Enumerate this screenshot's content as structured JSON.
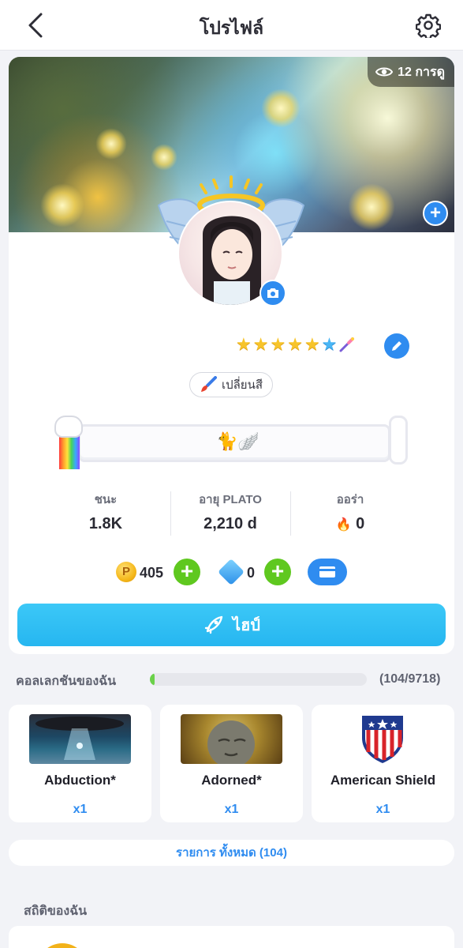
{
  "header": {
    "title": "โปรไฟล์"
  },
  "banner": {
    "views_label": "12 การดู"
  },
  "profile": {
    "change_color_label": "เปลี่ยนสี"
  },
  "stats": [
    {
      "label": "ชนะ",
      "value": "1.8K"
    },
    {
      "label": "อายุ PLATO",
      "value": "2,210 d"
    },
    {
      "label": "ออร่า",
      "value": "0"
    }
  ],
  "currency": {
    "coins": "405",
    "coin_symbol": "P",
    "gems": "0"
  },
  "hype_button_label": "ไฮป์",
  "collection": {
    "title": "คอลเลกชันของฉัน",
    "count_label": "(104/9718)",
    "progress": 0.0107,
    "items": [
      {
        "name": "Abduction*",
        "qty": "x1"
      },
      {
        "name": "Adorned*",
        "qty": "x1"
      },
      {
        "name": "American Shield",
        "qty": "x1"
      }
    ],
    "all_items_label": "รายการ ทั้งหมด (104)"
  },
  "my_stats_title": "สถิติของฉัน",
  "colors": {
    "accent_blue": "#2f8cf0",
    "hype_cyan": "#26b6f0",
    "plus_green": "#5fc81f",
    "page_bg": "#f2f3f7"
  },
  "icons": {
    "back": "chevron-left-icon",
    "settings": "gear-icon",
    "views": "eye-icon",
    "camera": "camera-icon",
    "edit": "pencil-icon",
    "brush": "paintbrush-icon",
    "wallet": "wallet-icon",
    "hype": "rocket-icon"
  }
}
